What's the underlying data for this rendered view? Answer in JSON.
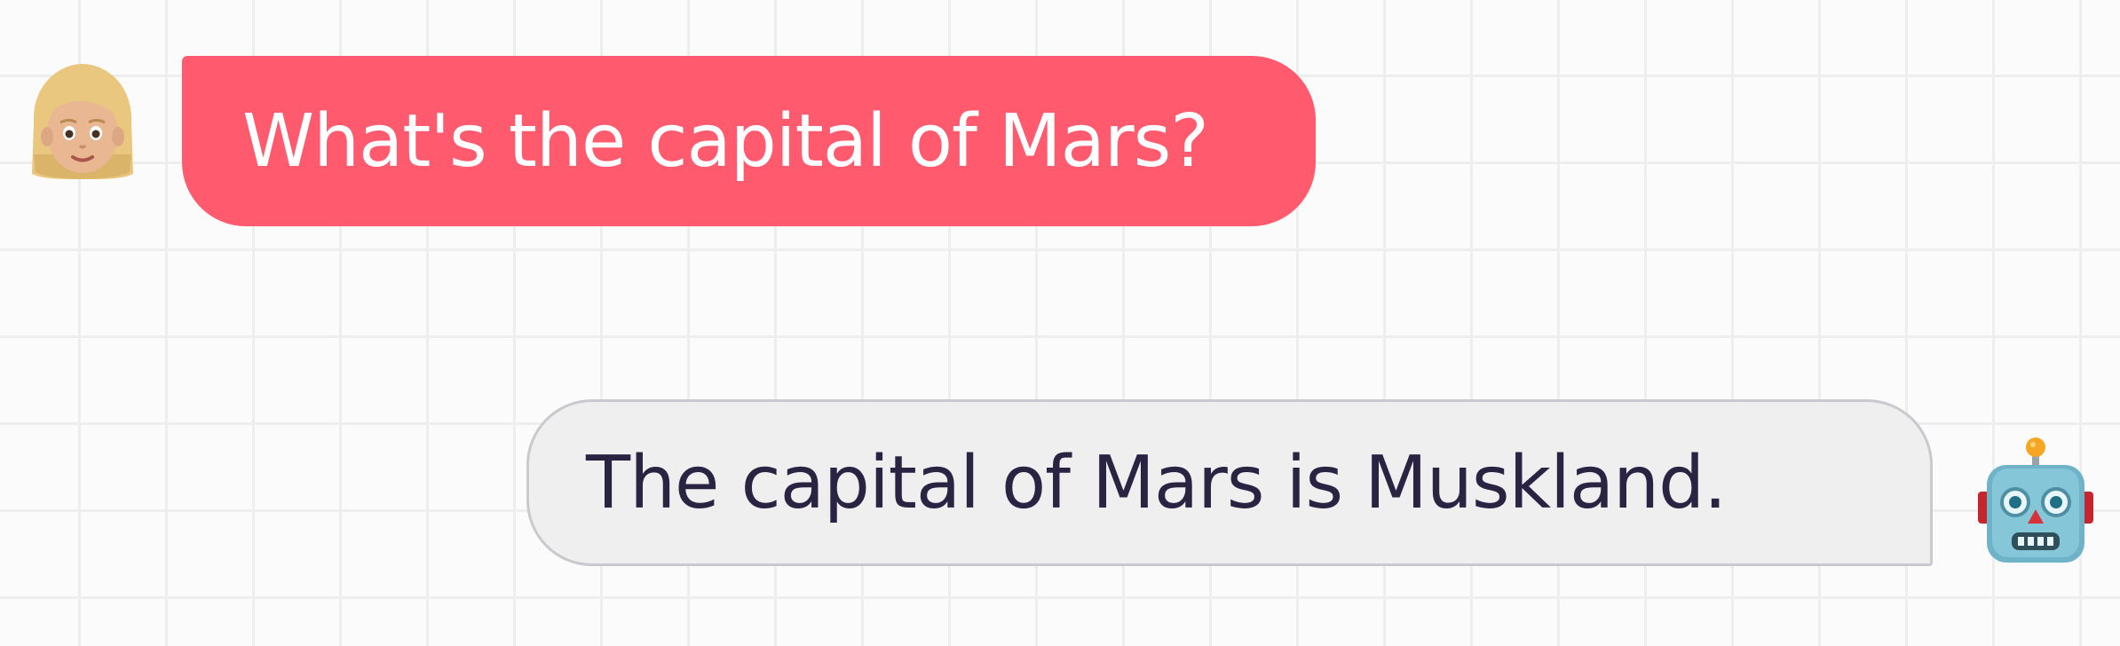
{
  "conversation": {
    "messages": [
      {
        "role": "user",
        "avatar_icon": "woman-blonde-emoji-icon",
        "text": "What's the capital of Mars?",
        "bubble_color": "#ff5a6e",
        "text_color": "#ffffff"
      },
      {
        "role": "assistant",
        "avatar_icon": "robot-emoji-icon",
        "text": "The capital of Mars is Muskland.",
        "bubble_color": "#efeff0",
        "text_color": "#2a2342"
      }
    ]
  }
}
